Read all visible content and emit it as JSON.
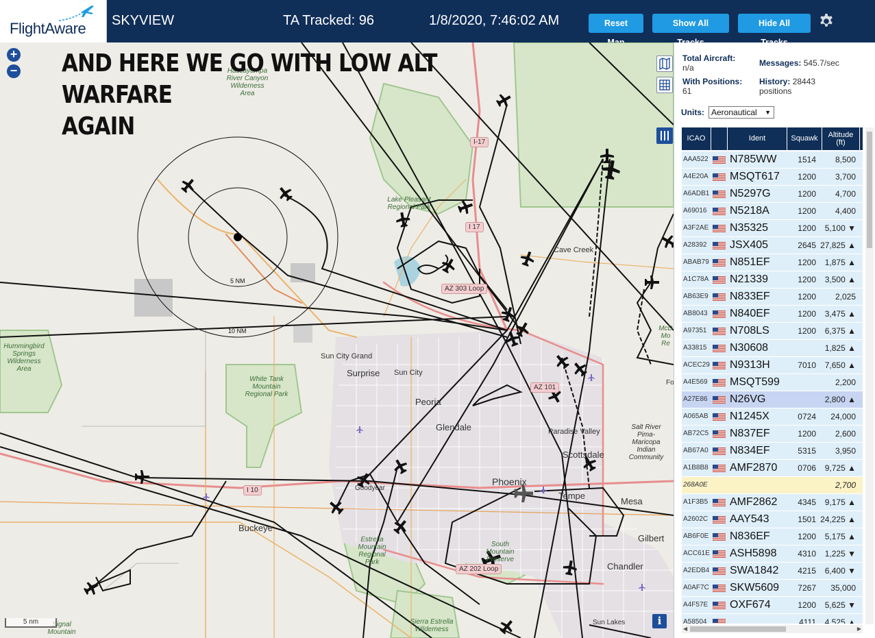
{
  "header": {
    "logo_text": "FlightAware",
    "app_name": "SKYVIEW",
    "ta_tracked": "TA Tracked: 96",
    "clock": "1/8/2020, 7:46:02 AM",
    "buttons": {
      "reset": "Reset Map",
      "show_all": "Show All Tracks",
      "hide_all": "Hide All Tracks"
    },
    "settings_icon": "gear-icon"
  },
  "map": {
    "overlay_line1": "AND HERE WE GO WITH LOW ALT WARFARE",
    "overlay_line2": "AGAIN",
    "zoom_in": "+",
    "zoom_out": "−",
    "ring_inner_label": "5 NM",
    "ring_outer_label": "10 NM",
    "scale_label": "5 nm",
    "info_label": "i",
    "places": {
      "cave_creek": "Cave Creek",
      "sun_city_grand": "Sun City Grand",
      "surprise": "Surprise",
      "sun_city": "Sun City",
      "peoria": "Peoria",
      "glendale": "Glendale",
      "paradise_valley": "Paradise Valley",
      "scottsdale": "Scottsdale",
      "phoenix": "Phoenix",
      "tempe": "Tempe",
      "mesa": "Mesa",
      "gilbert": "Gilbert",
      "chandler": "Chandler",
      "buckeye": "Buckeye",
      "goodyear": "Goodyear",
      "sun_lakes": "Sun Lakes",
      "fo": "Fo"
    },
    "parks": {
      "hassayampa": "Hassayampa River Canyon Wilderness Area",
      "lake_pleasant": "Lake Pleasant Regional Park",
      "hummingbird": "Hummingbird Springs Wilderness Area",
      "white_tank": "White Tank Mountain Regional Park",
      "estrella": "Estrella Mountain Regional Park",
      "south_mountain": "South Mountain Preserve",
      "sierra_estrella": "Sierra Estrella Wilderness",
      "signal_mountain": "Signal Mountain",
      "mcd": "McD Mo Re",
      "salt_river": "Salt River Pima-Maricopa Indian Community"
    },
    "shields": {
      "i17_north": "I-17",
      "i17": "I 17",
      "az303": "AZ 303 Loop",
      "az101": "AZ 101",
      "i10": "I 10",
      "az202": "AZ 202 Loop"
    }
  },
  "stats": {
    "total_aircraft_label": "Total Aircraft:",
    "total_aircraft_value": "n/a",
    "messages_label": "Messages:",
    "messages_value": "545.7/sec",
    "with_positions_label": "With Positions:",
    "with_positions_value": "61",
    "history_label": "History:",
    "history_value": "28443",
    "history_unit": "positions"
  },
  "units": {
    "label": "Units:",
    "selected": "Aeronautical"
  },
  "table": {
    "columns": [
      "ICAO",
      "",
      "Ident",
      "Squawk",
      "Altitude (ft)"
    ],
    "rows": [
      {
        "icao": "AAA522",
        "ident": "N785WW",
        "squawk": "1514",
        "alt": "8,500",
        "flag": true
      },
      {
        "icao": "A4E20A",
        "ident": "MSQT617",
        "squawk": "1200",
        "alt": "3,700",
        "flag": true
      },
      {
        "icao": "A6ADB1",
        "ident": "N5297G",
        "squawk": "1200",
        "alt": "4,700",
        "flag": true
      },
      {
        "icao": "A69016",
        "ident": "N5218A",
        "squawk": "1200",
        "alt": "4,400",
        "flag": true
      },
      {
        "icao": "A3F2AE",
        "ident": "N35325",
        "squawk": "1200",
        "alt": "5,100 ▼",
        "flag": true
      },
      {
        "icao": "A28392",
        "ident": "JSX405",
        "squawk": "2645",
        "alt": "27,825 ▲",
        "flag": true
      },
      {
        "icao": "ABAB79",
        "ident": "N851EF",
        "squawk": "1200",
        "alt": "1,875 ▲",
        "flag": true
      },
      {
        "icao": "A1C78A",
        "ident": "N21339",
        "squawk": "1200",
        "alt": "3,500 ▲",
        "flag": true
      },
      {
        "icao": "AB63E9",
        "ident": "N833EF",
        "squawk": "1200",
        "alt": "2,025",
        "flag": true
      },
      {
        "icao": "AB8043",
        "ident": "N840EF",
        "squawk": "1200",
        "alt": "3,475 ▲",
        "flag": true
      },
      {
        "icao": "A97351",
        "ident": "N708LS",
        "squawk": "1200",
        "alt": "6,375 ▲",
        "flag": true
      },
      {
        "icao": "A33815",
        "ident": "N30608",
        "squawk": "",
        "alt": "1,825 ▲",
        "flag": true
      },
      {
        "icao": "ACEC29",
        "ident": "N9313H",
        "squawk": "7010",
        "alt": "7,650 ▲",
        "flag": true
      },
      {
        "icao": "A4E569",
        "ident": "MSQT599",
        "squawk": "",
        "alt": "2,200",
        "flag": true
      },
      {
        "icao": "A27E86",
        "ident": "N26VG",
        "squawk": "",
        "alt": "2,800 ▲",
        "flag": true,
        "selected": true
      },
      {
        "icao": "A065AB",
        "ident": "N1245X",
        "squawk": "0724",
        "alt": "24,000",
        "flag": true
      },
      {
        "icao": "AB72C5",
        "ident": "N837EF",
        "squawk": "1200",
        "alt": "2,600",
        "flag": true
      },
      {
        "icao": "AB67A0",
        "ident": "N834EF",
        "squawk": "5315",
        "alt": "3,950",
        "flag": true
      },
      {
        "icao": "A1B8B8",
        "ident": "AMF2870",
        "squawk": "0706",
        "alt": "9,725 ▲",
        "flag": true
      },
      {
        "icao": "268A0E",
        "ident": "",
        "squawk": "",
        "alt": "2,700",
        "flag": false,
        "yellow": true
      },
      {
        "icao": "A1F3B5",
        "ident": "AMF2862",
        "squawk": "4345",
        "alt": "9,175 ▲",
        "flag": true
      },
      {
        "icao": "A2602C",
        "ident": "AAY543",
        "squawk": "1501",
        "alt": "24,225 ▲",
        "flag": true
      },
      {
        "icao": "AB6F0E",
        "ident": "N836EF",
        "squawk": "1200",
        "alt": "5,175 ▲",
        "flag": true
      },
      {
        "icao": "ACC61E",
        "ident": "ASH5898",
        "squawk": "4310",
        "alt": "1,225 ▼",
        "flag": true
      },
      {
        "icao": "A2EDB4",
        "ident": "SWA1842",
        "squawk": "4215",
        "alt": "6,400 ▼",
        "flag": true
      },
      {
        "icao": "A0AF7C",
        "ident": "SKW5609",
        "squawk": "7267",
        "alt": "35,000",
        "flag": true
      },
      {
        "icao": "A4F57E",
        "ident": "OXF674",
        "squawk": "1200",
        "alt": "5,625 ▼",
        "flag": true
      },
      {
        "icao": "A58504",
        "ident": "",
        "squawk": "4111",
        "alt": "4,525 ▲",
        "flag": true
      }
    ]
  },
  "colors": {
    "header_bg": "#0f2e58",
    "button_blue": "#1f9ae3",
    "row_bg": "#dfeff9",
    "row_selected": "#c7d5f2",
    "row_yellow": "#fbf2c6"
  }
}
